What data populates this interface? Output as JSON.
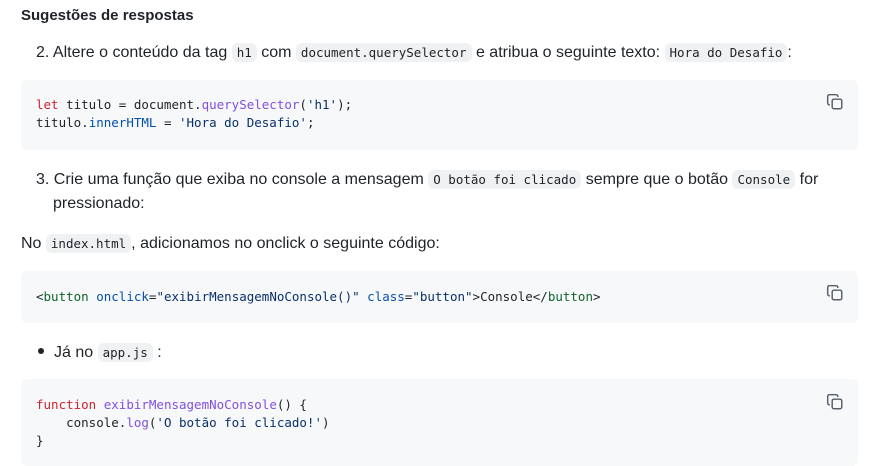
{
  "heading": "Sugestões de respostas",
  "item2": {
    "number": "2.",
    "text_a": "Altere o conteúdo da tag",
    "code_a": "h1",
    "text_b": "com",
    "code_b": "document.querySelector",
    "text_c": "e atribua o seguinte texto:",
    "code_c": "Hora do Desafio",
    "text_d": ":"
  },
  "code1": {
    "l1_let": "let",
    "l1_a": " titulo = document.",
    "l1_fn": "querySelector",
    "l1_b": "(",
    "l1_str": "'h1'",
    "l1_c": ");",
    "l2_a": "titulo.",
    "l2_prop": "innerHTML",
    "l2_b": " = ",
    "l2_str": "'Hora do Desafio'",
    "l2_c": ";"
  },
  "item3": {
    "number": "3.",
    "text_a": "Crie uma função que exiba no console a mensagem",
    "code_a": "O botão foi clicado",
    "text_b": "sempre que o botão",
    "code_b": "Console",
    "text_c": "for",
    "line2": "pressionado:"
  },
  "para_no": {
    "text_a": "No",
    "code_a": "index.html",
    "text_b": ", adicionamos no onclick o seguinte código:"
  },
  "code2": {
    "lt": "<",
    "tag1": "button",
    "attr1": " onclick",
    "eq1": "=",
    "val1": "\"exibirMensagemNoConsole()\"",
    "attr2": " class",
    "eq2": "=",
    "val2": "\"button\"",
    "gt": ">",
    "content": "Console",
    "close_lt": "</",
    "tag2": "button",
    "close_gt": ">"
  },
  "bullet": {
    "text_a": "Já no",
    "code_a": "app.js",
    "text_b": ":"
  },
  "code3": {
    "l1_kw": "function",
    "l1_sp": " ",
    "l1_fn": "exibirMensagemNoConsole",
    "l1_b": "() {",
    "l2_a": "    console.",
    "l2_fn": "log",
    "l2_b": "(",
    "l2_str": "'O botão foi clicado!'",
    "l2_c": ")",
    "l3": "}"
  },
  "icons": {
    "copy": "copy-icon"
  },
  "colors": {
    "code_bg": "#f6f8fa",
    "keyword": "#cf222e",
    "function": "#8250df",
    "string": "#0a3069"
  }
}
